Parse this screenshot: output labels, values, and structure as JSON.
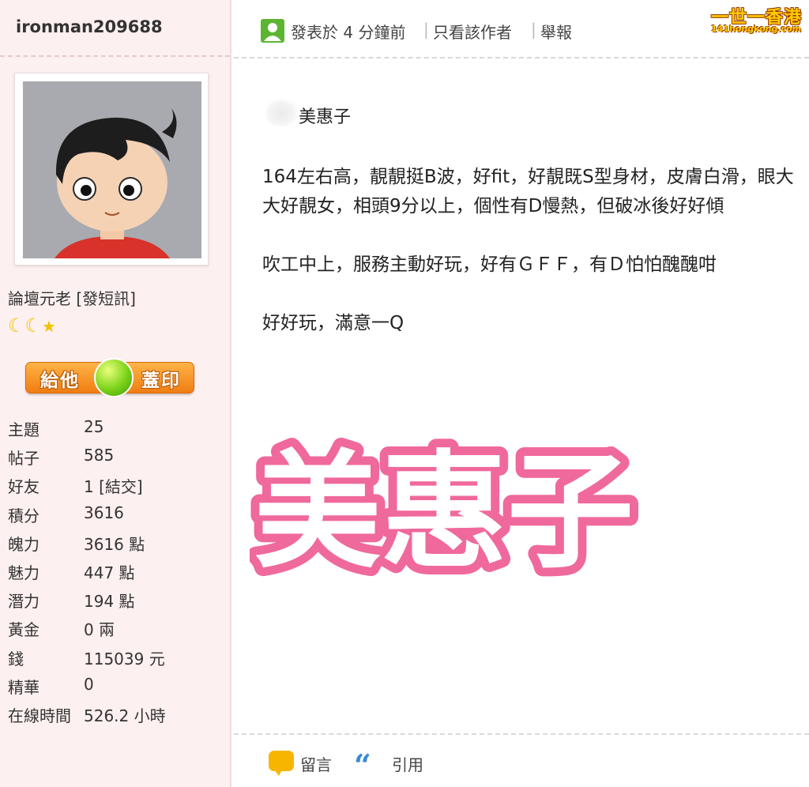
{
  "user": {
    "username": "ironman209688",
    "rank": "論壇元老",
    "pm_link": "[發短訊]",
    "stamp_button": {
      "left": "給他",
      "right": "蓋印"
    },
    "stats": [
      {
        "key": "主題",
        "value": "25"
      },
      {
        "key": "帖子",
        "value": "585"
      },
      {
        "key": "好友",
        "value": "1 [結交]"
      },
      {
        "key": "積分",
        "value": "3616"
      },
      {
        "key": "魄力",
        "value": "3616 點"
      },
      {
        "key": "魅力",
        "value": "447 點"
      },
      {
        "key": "潛力",
        "value": "194 點"
      },
      {
        "key": "黃金",
        "value": "0 兩"
      },
      {
        "key": "錢",
        "value": "115039 元"
      },
      {
        "key": "精華",
        "value": "0"
      },
      {
        "key": "在線時間",
        "value": "526.2 小時"
      }
    ]
  },
  "header": {
    "posted": "發表於 4 分鐘前",
    "author_only": "只看該作者",
    "report": "舉報",
    "separator": "|"
  },
  "logo": {
    "name": "一世一香港",
    "domain": "141hongkong.com"
  },
  "post": {
    "title": "美惠子",
    "paragraphs": [
      "164左右高，靚靚挺B波，好fit，好靚既S型身材，皮膚白滑，眼大大好靚女，相頭9分以上，個性有D慢熱，但破冰後好好傾",
      "吹工中上，服務主動好玩，好有ＧＦＦ，有Ｄ怕怕醜醜咁",
      "好好玩，滿意一Q"
    ],
    "watermark": "美惠子"
  },
  "footer": {
    "comment": "留言",
    "quote": "引用"
  },
  "colors": {
    "sidebar_bg": "#fdf0f0",
    "accent_pink": "#f0699c",
    "stamp_orange": "#f07d12",
    "user_icon_green": "#5cb531"
  }
}
